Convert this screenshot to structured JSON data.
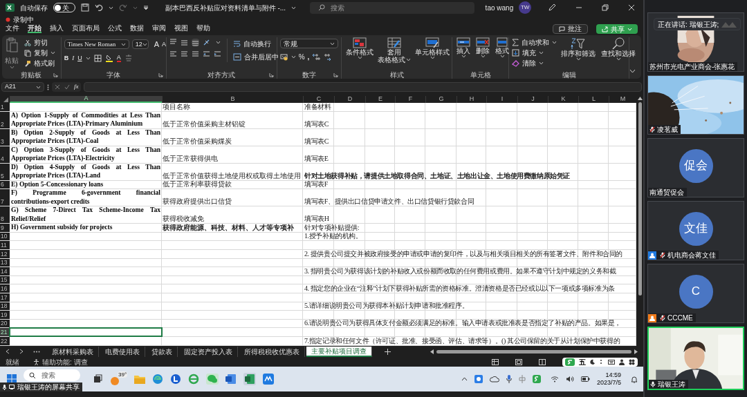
{
  "title_bar": {
    "autosave_label": "自动保存",
    "autosave_on": false,
    "autosave_state": "关",
    "document_title": "副本巴西反补贴应对资料清单与附件 -...",
    "search_placeholder": "搜索",
    "user_name": "tao wang",
    "user_initials": "TW"
  },
  "recording": "录制中",
  "menu_tabs": [
    {
      "label": "文件",
      "selected": false
    },
    {
      "label": "开始",
      "selected": true
    },
    {
      "label": "插入",
      "selected": false
    },
    {
      "label": "页面布局",
      "selected": false
    },
    {
      "label": "公式",
      "selected": false
    },
    {
      "label": "数据",
      "selected": false
    },
    {
      "label": "审阅",
      "selected": false
    },
    {
      "label": "视图",
      "selected": false
    },
    {
      "label": "帮助",
      "selected": false
    }
  ],
  "comment_button": "批注",
  "share_button": "共享",
  "ribbon": {
    "clipboard": {
      "title": "剪贴板",
      "paste": "粘贴",
      "cut": "剪切",
      "copy": "复制",
      "format_painter": "格式刷"
    },
    "font": {
      "title": "字体",
      "font_name": "Times New Roman",
      "font_size": "12",
      "grow_letter": "A",
      "shrink_letter": "A",
      "style_letters": [
        "B",
        "I",
        "U"
      ],
      "color_letter": "A"
    },
    "alignment": {
      "title": "对齐方式",
      "wrap_text": "自动换行",
      "merge_center": "合并后居中"
    },
    "number": {
      "title": "数字",
      "format": "常规",
      "percent": "%",
      "comma": ","
    },
    "styles": {
      "title": "样式",
      "conditional": "条件格式",
      "table_format": [
        "套用",
        "表格格式"
      ],
      "cell_styles": "单元格样式"
    },
    "cells": {
      "title": "单元格",
      "insert": "插入",
      "delete": "删除",
      "format": "格式"
    },
    "editing": {
      "title": "编辑",
      "autosum": "自动求和",
      "fill": "填充",
      "clear": "清除",
      "sort_filter": "排序和筛选",
      "find_select": "查找和选择"
    }
  },
  "formula_bar": {
    "name_box": "A21",
    "function_label": "fx"
  },
  "columns": [
    {
      "label": "A",
      "selected": true
    },
    {
      "label": "B",
      "selected": false
    },
    {
      "label": "C",
      "selected": false
    },
    {
      "label": "D",
      "selected": false
    },
    {
      "label": "E",
      "selected": false
    },
    {
      "label": "F",
      "selected": false
    },
    {
      "label": "G",
      "selected": false
    },
    {
      "label": "H",
      "selected": false
    },
    {
      "label": "I",
      "selected": false
    },
    {
      "label": "J",
      "selected": false
    },
    {
      "label": "K",
      "selected": false
    },
    {
      "label": "L",
      "selected": false
    },
    {
      "label": "M",
      "selected": false
    }
  ],
  "rows": [
    {
      "number": "1",
      "selected": false,
      "b": {
        "text": "项目名称",
        "bold": false
      },
      "c": {
        "text": "准备材料",
        "bold": false
      }
    },
    {
      "number": "2",
      "selected": false,
      "a": "A) Option 1-Supply of Commodities at Less Than Appropriate Prices (LTA)-Primary Aluminium",
      "b": {
        "text": "低于正常价值采购主材铝锭",
        "bold": false
      },
      "c": {
        "text": "填写表C",
        "bold": false
      }
    },
    {
      "number": "3",
      "selected": false,
      "a": "B) Option 2-Supply of Goods at Less Than Appropriate Prices (LTA)-Coal",
      "b": {
        "text": "低于正常价值采购煤炭",
        "bold": false
      },
      "c": {
        "text": "填写表C",
        "bold": false
      }
    },
    {
      "number": "4",
      "selected": false,
      "a": "C) Option 3-Supply of Goods at Less Than Appropriate Prices (LTA)-Electricity",
      "b": {
        "text": "低于正常获得供电",
        "bold": false
      },
      "c": {
        "text": "填写表E",
        "bold": false
      }
    },
    {
      "number": "5",
      "selected": false,
      "a": "D) Option 4-Supply of Goods at Less Than Appropriate Prices (LTA)-Land",
      "b": {
        "text": "低于正常价值获得土地使用权或取得土地使用",
        "bold": false
      },
      "c": {
        "text": "针对土地获得补贴，请提供土地取得合同、土地证、土地出让金、土地使用费缴纳原始凭证",
        "bold": true
      }
    },
    {
      "number": "6",
      "selected": false,
      "a": "E) Option 5-Concessionary loans",
      "b": {
        "text": "低于正常利率获得贷款",
        "bold": false
      },
      "c": {
        "text": "填写表F",
        "bold": false
      }
    },
    {
      "number": "7",
      "selected": false,
      "a": "F) Programme 6-government financial contributions-export credits",
      "b": {
        "text": "获得政府提供出口信贷",
        "bold": false
      },
      "c": {
        "text": "填写表F、提供出口信贷申请文件、出口信贷银行贷款合同",
        "bold": false
      }
    },
    {
      "number": "8",
      "selected": false,
      "a": "G) Scheme 7-Direct Tax Scheme-Income Tax Relief/Relief",
      "b": {
        "text": "获得税收减免",
        "bold": false
      },
      "c": {
        "text": "填写表H",
        "bold": false
      }
    },
    {
      "number": "9",
      "selected": false,
      "a": "H) Government subsidy for projects",
      "b": {
        "text": "获得政府能源、科技、材料、人才等专项补",
        "bold": true
      },
      "c": {
        "text": "针对专项补贴提供:",
        "bold": false
      }
    },
    {
      "number": "10",
      "selected": false,
      "c": {
        "text": "1.授予补贴的机构。",
        "bold": false
      }
    },
    {
      "number": "11",
      "selected": false
    },
    {
      "number": "12",
      "selected": false,
      "c": {
        "text": "2. 提供贵公司提交并被政府接受的申请或申请的复印件，以及与相关项目相关的所有签署文件、附件和合同的",
        "bold": false
      }
    },
    {
      "number": "13",
      "selected": false
    },
    {
      "number": "14",
      "selected": false,
      "c": {
        "text": "3. 指明贵公司为获得该计划的补贴收入或份额而收取的任何费用或费用。如果不遵守计划中规定的义务和截",
        "bold": false
      }
    },
    {
      "number": "15",
      "selected": false
    },
    {
      "number": "16",
      "selected": false,
      "c": {
        "text": "4. 指定您的企业在“注释”计划下获得补贴所需的资格标准。澄清资格是否已经或以以下一项或多项标准为条",
        "bold": false
      }
    },
    {
      "number": "17",
      "selected": false
    },
    {
      "number": "18",
      "selected": false,
      "c": {
        "text": "5.请详细说明贵公司为获得本补贴计划申请和批准程序。",
        "bold": false
      }
    },
    {
      "number": "19",
      "selected": false
    },
    {
      "number": "20",
      "selected": false,
      "c": {
        "text": "6.请说明贵公司为获得具体支付金额必须满足的标准。输入申请表或批准表是否指定了补贴的产品。如果是，",
        "bold": false
      }
    },
    {
      "number": "21",
      "selected": true
    },
    {
      "number": "22",
      "selected": false,
      "c": {
        "text": "7.指定记录和任何文件（许可证、批准、接受函、评估、请求等）。() 其公司保留的关于从计划保护中获得的",
        "bold": false
      }
    }
  ],
  "sheet_tabs": [
    {
      "label": "原材料采购表",
      "selected": false
    },
    {
      "label": "电费使用表",
      "selected": false
    },
    {
      "label": "贷款表",
      "selected": false
    },
    {
      "label": "固定资产投入表",
      "selected": false
    },
    {
      "label": "所得税税收优惠表",
      "selected": false
    },
    {
      "label": "主要补贴项目调查",
      "selected": true
    }
  ],
  "status_bar": {
    "ready": "就绪",
    "accessibility": "辅助功能: 调查",
    "ime": "五"
  },
  "taskbar": {
    "search_placeholder": "搜索",
    "temperature": "39°",
    "time": "14:59",
    "date": "2023/7/5"
  },
  "screen_share_label": "瑞银王涛的屏幕共享",
  "meeting": {
    "speaking_banner": "正在讲话: 瑞银王涛;",
    "tiles": [
      {
        "kind": "video",
        "name": "苏州市光电产业商会-张惠花",
        "speaking": false
      },
      {
        "kind": "video",
        "name": "凌茗威",
        "muted": true,
        "speaking": false
      },
      {
        "kind": "avatar",
        "initials": "促会",
        "name": "南通贸促会",
        "speaking": false
      },
      {
        "kind": "avatar",
        "initials": "文佳",
        "name": "机电商会蒋文佳",
        "muted": true,
        "color": "#1f7ae0",
        "speaking": false
      },
      {
        "kind": "avatar",
        "initials": "C",
        "name": "CCCME",
        "muted": true,
        "color": "#f07a1a",
        "speaking": false
      },
      {
        "kind": "video",
        "name": "瑞银王涛",
        "muted": false,
        "speaking": true
      }
    ]
  }
}
